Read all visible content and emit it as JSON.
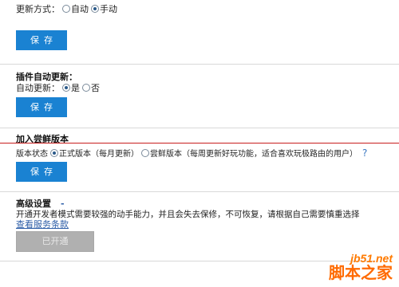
{
  "update_mode": {
    "label": "更新方式：",
    "options": [
      {
        "label": "自动",
        "checked": false
      },
      {
        "label": "手动",
        "checked": true
      }
    ],
    "save_label": "保存"
  },
  "plugin_update": {
    "title": "插件自动更新：",
    "label": "自动更新：",
    "options": [
      {
        "label": "是",
        "checked": true
      },
      {
        "label": "否",
        "checked": false
      }
    ],
    "save_label": "保存"
  },
  "beta": {
    "title": "加入尝鲜版本",
    "label": "版本状态",
    "options": [
      {
        "label": "正式版本（每月更新）",
        "checked": true
      },
      {
        "label": "尝鲜版本（每周更新好玩功能，适合喜欢玩极路由的用户）",
        "checked": false
      }
    ],
    "help_icon": "?",
    "save_label": "保存"
  },
  "advanced": {
    "title": "高级设置",
    "marker": "-",
    "description": "开通开发者模式需要较强的动手能力，并且会失去保修，不可恢复，请根据自己需要慎重选择",
    "terms_link": "查看服务条款",
    "enabled_button_label": "已开通"
  },
  "watermark": {
    "line1": "jb51.net",
    "line2": "脚本之家"
  },
  "colors": {
    "primary_button": "#1a82d2",
    "disabled_button": "#b0b0b0",
    "section_divider_red": "#c81e1e",
    "link": "#2f5fa8"
  }
}
